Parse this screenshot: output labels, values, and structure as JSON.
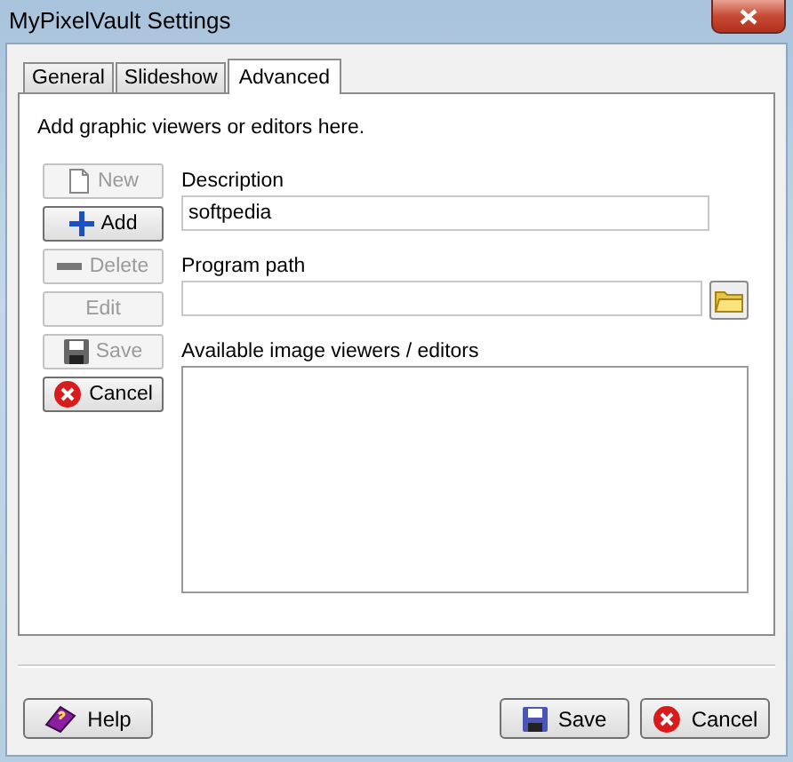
{
  "window": {
    "title": "MyPixelVault Settings"
  },
  "tabs": [
    {
      "label": "General",
      "selected": false
    },
    {
      "label": "Slideshow",
      "selected": false
    },
    {
      "label": "Advanced",
      "selected": true
    }
  ],
  "intro": "Add graphic viewers or editors here.",
  "side_buttons": [
    {
      "kind": "new",
      "label": "New",
      "disabled": true
    },
    {
      "kind": "add",
      "label": "Add",
      "disabled": false
    },
    {
      "kind": "delete",
      "label": "Delete",
      "disabled": true
    },
    {
      "kind": "edit",
      "label": "Edit",
      "disabled": true
    },
    {
      "kind": "save",
      "label": "Save",
      "disabled": true
    },
    {
      "kind": "cancel",
      "label": "Cancel",
      "disabled": false
    }
  ],
  "description": {
    "label": "Description",
    "value": "softpedia"
  },
  "program_path": {
    "label": "Program path"
  },
  "viewers": {
    "label": "Available image viewers / editors"
  },
  "footer_buttons": [
    {
      "kind": "help",
      "label": "Help"
    },
    {
      "kind": "save",
      "label": "Save"
    },
    {
      "kind": "cancel",
      "label": "Cancel"
    }
  ]
}
